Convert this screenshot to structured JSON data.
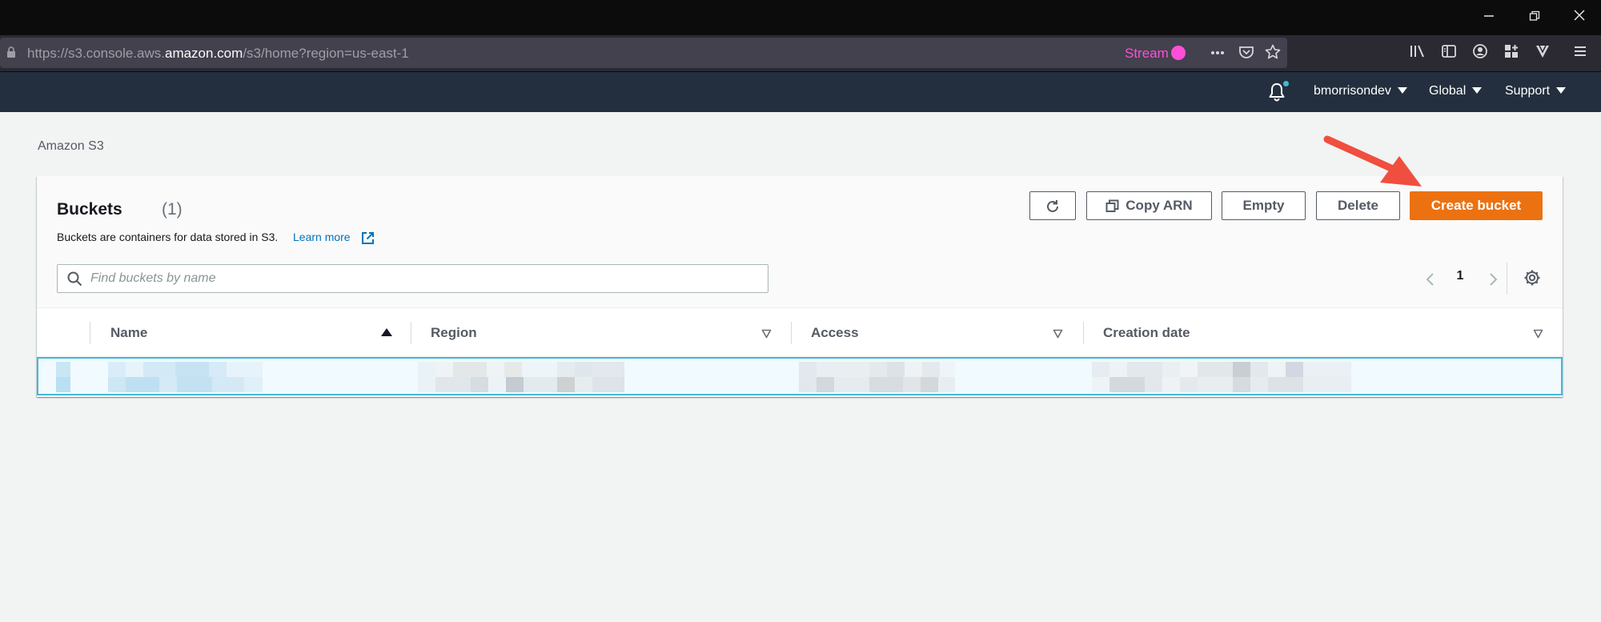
{
  "window": {
    "controls": [
      {
        "name": "minimize",
        "glyph": "—"
      },
      {
        "name": "restore",
        "glyph": "❐"
      },
      {
        "name": "close",
        "glyph": "✕"
      }
    ]
  },
  "browser": {
    "url_prefix": "https://s3.console.aws.",
    "url_host": "amazon.com",
    "url_path": "/s3/home?region=us-east-1",
    "stream_label": "Stream",
    "stream_color": "#ff4fd8",
    "url_icons": [
      "more-icon",
      "pocket-icon",
      "star-icon"
    ],
    "toolbar_icons": [
      "library-icon",
      "sidebar-icon",
      "account-icon",
      "extensions-icon",
      "vivaldi-icon",
      "menu-icon"
    ]
  },
  "aws_nav": {
    "bg_color": "#232f3e",
    "notification_icon": "bell-icon",
    "user": "bmorrisondev",
    "region": "Global",
    "support": "Support"
  },
  "breadcrumb": "Amazon S3",
  "buckets": {
    "title": "Buckets",
    "count": "(1)",
    "description": "Buckets are containers for data stored in S3.",
    "learn_more": "Learn more",
    "buttons": {
      "refresh_icon": "refresh-icon",
      "copy_arn": "Copy ARN",
      "empty": "Empty",
      "delete": "Delete",
      "create": "Create bucket"
    },
    "primary_color": "#ec7211",
    "search_placeholder": "Find buckets by name",
    "page": "1",
    "columns": {
      "name": "Name",
      "region": "Region",
      "access": "Access",
      "creation_date": "Creation date"
    },
    "sort_column": "Name",
    "sort_direction": "ascending",
    "rows": [
      {
        "selected": true,
        "content": "pixelated / redacted"
      }
    ],
    "selection_color": "#44b9d6"
  },
  "annotation": {
    "type": "arrow",
    "color": "#f04e3e",
    "points_to": "Create bucket"
  }
}
